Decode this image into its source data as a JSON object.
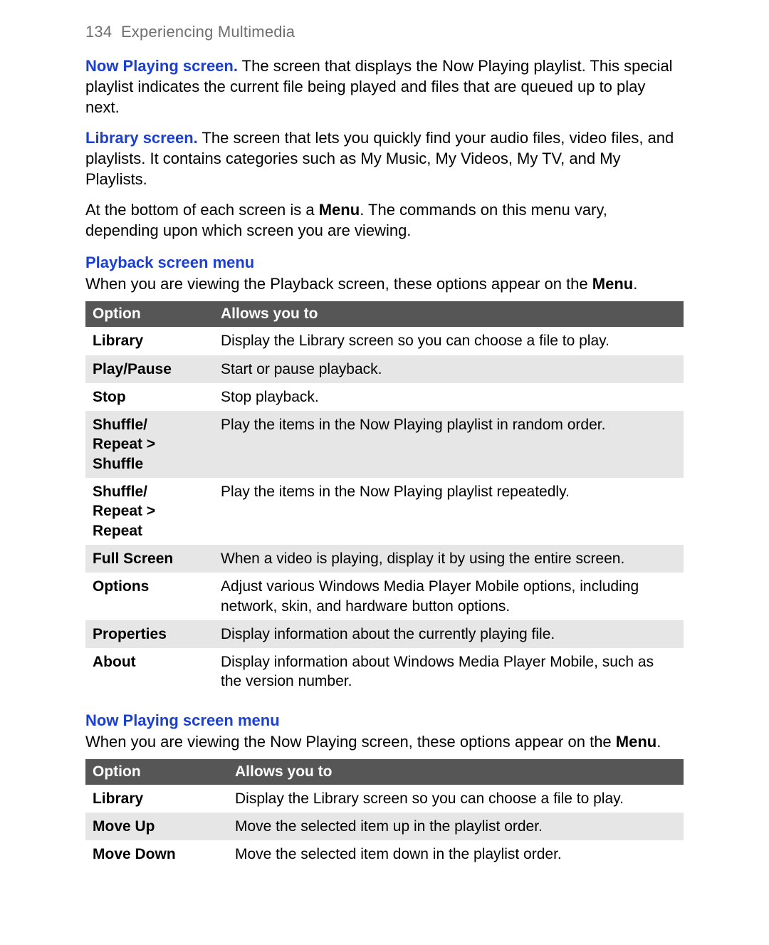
{
  "header": {
    "page_number": "134",
    "chapter": "Experiencing Multimedia"
  },
  "paragraphs": {
    "now_playing": {
      "label": "Now Playing screen.",
      "text": " The screen that displays the Now Playing playlist. This special playlist indicates the current file being played and files that are queued up to play next."
    },
    "library": {
      "label": "Library screen.",
      "text": " The screen that lets you quickly find your audio files, video files, and playlists. It contains categories such as My Music, My Videos, My TV, and My Playlists."
    },
    "menu_intro": {
      "before": "At the bottom of each screen is a ",
      "bold": "Menu",
      "after": ". The commands on this menu vary, depending upon which screen you are viewing."
    }
  },
  "section1": {
    "heading": "Playback screen menu",
    "intro_before": "When you are viewing the Playback screen, these options appear on the ",
    "intro_bold": "Menu",
    "intro_after": ".",
    "col1": "Option",
    "col2": "Allows you to",
    "rows": [
      {
        "option": "Library",
        "desc": "Display the Library screen so you can choose a file to play."
      },
      {
        "option": "Play/Pause",
        "desc": "Start or pause playback."
      },
      {
        "option": "Stop",
        "desc": "Stop playback."
      },
      {
        "option": "Shuffle/\nRepeat > Shuffle",
        "desc": "Play the items in the Now Playing playlist in random order."
      },
      {
        "option": "Shuffle/\nRepeat > Repeat",
        "desc": "Play the items in the Now Playing playlist repeatedly."
      },
      {
        "option": "Full Screen",
        "desc": "When a video is playing, display it by using the entire screen."
      },
      {
        "option": "Options",
        "desc": "Adjust various Windows Media Player Mobile options, including network, skin, and hardware button options."
      },
      {
        "option": "Properties",
        "desc": "Display information about the currently playing file."
      },
      {
        "option": "About",
        "desc": "Display information about Windows Media Player Mobile, such as the version number."
      }
    ]
  },
  "section2": {
    "heading": "Now Playing screen menu",
    "intro_before": "When you are viewing the Now Playing screen, these options appear on the ",
    "intro_bold": "Menu",
    "intro_after": ".",
    "col1": "Option",
    "col2": "Allows you to",
    "rows": [
      {
        "option": "Library",
        "desc": "Display the Library screen so you can choose a file to play."
      },
      {
        "option": "Move Up",
        "desc": "Move the selected item up in the playlist order."
      },
      {
        "option": "Move Down",
        "desc": "Move the selected item down in the playlist order."
      }
    ]
  }
}
